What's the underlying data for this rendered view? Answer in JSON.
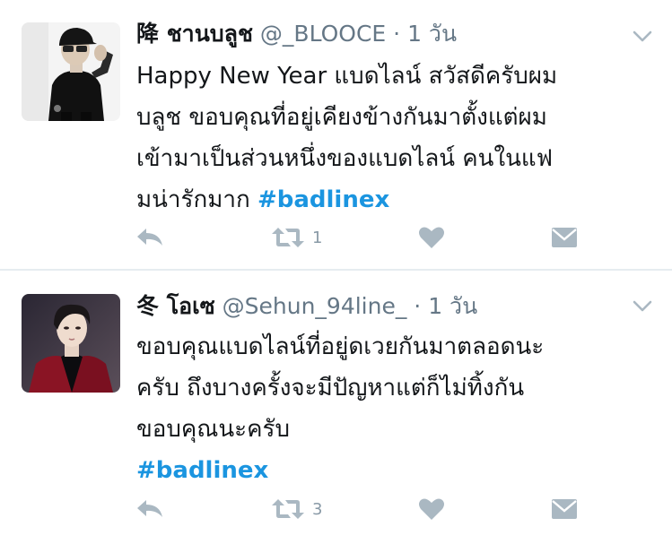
{
  "tweets": [
    {
      "display_name": "降 ชานบลูช",
      "handle": "@_BLOOCE",
      "separator": "·",
      "time": "1 วัน",
      "text_lines": [
        "Happy New Year แบดไลน์ สวัสดีครับผม",
        "บลูช ขอบคุณที่อยู่เคียงข้างกันมาตั้งแต่ผม",
        "เข้ามาเป็นส่วนหนึ่งของแบดไลน์ คนในแฟ",
        "มน่ารักมาก "
      ],
      "hashtag": "#badlinex",
      "retweet_count": "1",
      "icons": [
        "reply-icon",
        "retweet-icon",
        "heart-icon",
        "direct-message-icon",
        "chevron-down-icon"
      ]
    },
    {
      "display_name": "冬 โอเซ",
      "handle": "@Sehun_94line_",
      "separator": "·",
      "time": "1 วัน",
      "text_lines": [
        "ขอบคุณแบดไลน์ที่อยู่ดเวยกันมาตลอดนะ",
        "ครับ ถึงบางครั้งจะมีปัญหาแต่ก็ไม่ทิ้งกัน",
        "ขอบคุณนะครับ"
      ],
      "hashtag": "#badlinex",
      "retweet_count": "3",
      "icons": [
        "reply-icon",
        "retweet-icon",
        "heart-icon",
        "direct-message-icon",
        "chevron-down-icon"
      ]
    }
  ],
  "colors": {
    "link": "#1b95e0",
    "secondary_text": "#657786",
    "action_icon": "#aab8c2",
    "divider": "#e6ecf0"
  }
}
